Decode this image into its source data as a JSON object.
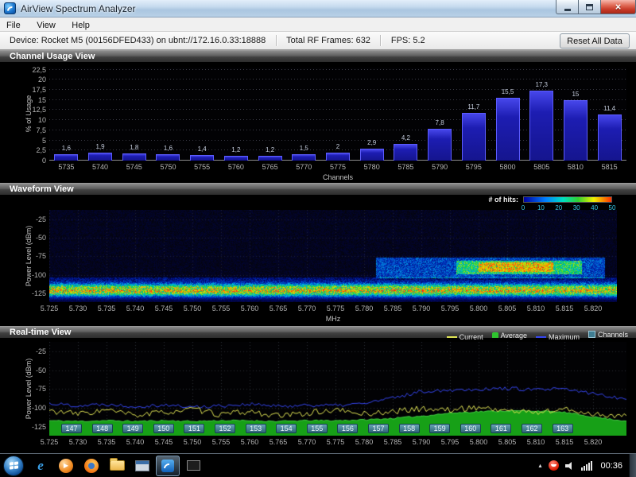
{
  "window": {
    "title": "AirView Spectrum Analyzer"
  },
  "glyphs": {
    "close": "×",
    "ie": "e",
    "play": "▶",
    "chevron": "▴"
  },
  "menu": {
    "items": [
      "File",
      "View",
      "Help"
    ]
  },
  "statusbar": {
    "device": "Device: Rocket M5 (00156DFED433) on ubnt://172.16.0.33:18888",
    "frames": "Total RF Frames: 632",
    "fps": "FPS: 5.2",
    "reset_button": "Reset All Data"
  },
  "channel_usage": {
    "title": "Channel Usage View",
    "ylabel": "% of Usage",
    "xlabel": "Channels"
  },
  "waveform": {
    "title": "Waveform View",
    "hits_label": "# of hits:",
    "hits_ticks": [
      "0",
      "10",
      "20",
      "30",
      "40",
      "50"
    ],
    "ylabel": "Power Level (dBm)",
    "xlabel": "MHz",
    "yticks": [
      -25,
      -50,
      -75,
      -100,
      -125
    ],
    "xticks": [
      "5.725",
      "5.730",
      "5.735",
      "5.740",
      "5.745",
      "5.750",
      "5.755",
      "5.760",
      "5.765",
      "5.770",
      "5.775",
      "5.780",
      "5.785",
      "5.790",
      "5.795",
      "5.800",
      "5.805",
      "5.810",
      "5.815",
      "5.820"
    ]
  },
  "realtime": {
    "title": "Real-time View",
    "ylabel": "Power Level (dBm)",
    "yticks": [
      -25,
      -50,
      -75,
      -100,
      -125
    ],
    "xticks": [
      "5.725",
      "5.730",
      "5.735",
      "5.740",
      "5.745",
      "5.750",
      "5.755",
      "5.760",
      "5.765",
      "5.770",
      "5.775",
      "5.780",
      "5.785",
      "5.790",
      "5.795",
      "5.800",
      "5.805",
      "5.810",
      "5.815",
      "5.820"
    ],
    "channels": [
      "147",
      "148",
      "149",
      "150",
      "151",
      "152",
      "153",
      "154",
      "155",
      "156",
      "157",
      "158",
      "159",
      "160",
      "161",
      "162",
      "163"
    ],
    "legend": [
      {
        "label": "Current",
        "color": "#e0e455",
        "type": "line"
      },
      {
        "label": "Average",
        "color": "#2ec42e",
        "type": "area"
      },
      {
        "label": "Maximum",
        "color": "#3646f0",
        "type": "line"
      },
      {
        "label": "Channels",
        "color": "#3f7d92",
        "type": "box"
      }
    ]
  },
  "taskbar": {
    "time": "00:36"
  },
  "chart_data": [
    {
      "type": "bar",
      "title": "Channel Usage View",
      "xlabel": "Channels",
      "ylabel": "% of Usage",
      "categories": [
        "5735",
        "5740",
        "5745",
        "5750",
        "5755",
        "5760",
        "5765",
        "5770",
        "5775",
        "5780",
        "5785",
        "5790",
        "5795",
        "5800",
        "5805",
        "5810",
        "5815"
      ],
      "values": [
        1.6,
        1.9,
        1.8,
        1.6,
        1.4,
        1.2,
        1.2,
        1.5,
        2,
        2.9,
        4.2,
        7.8,
        11.7,
        15.5,
        17.3,
        15,
        11.4
      ],
      "value_labels": [
        "1,6",
        "1,9",
        "1,8",
        "1,6",
        "1,4",
        "1,2",
        "1,2",
        "1,5",
        "2",
        "2,9",
        "4,2",
        "7,8",
        "11,7",
        "15,5",
        "17,3",
        "15",
        "11,4"
      ],
      "ylim": [
        0,
        23
      ],
      "ytick_values": [
        0,
        2.5,
        5,
        7.5,
        10,
        12.5,
        15,
        17.5,
        20,
        22.5
      ],
      "ytick_labels": [
        "0",
        "2,5",
        "5",
        "7,5",
        "10",
        "12,5",
        "15",
        "17,5",
        "20",
        "22,5"
      ],
      "grid_values": [
        2.5,
        5,
        7.5,
        10,
        12.5,
        15,
        17.5,
        20,
        22.5
      ],
      "bar_color": "#2222c8",
      "grid": true,
      "legend_position": "none"
    },
    {
      "type": "heatmap",
      "title": "Waveform View",
      "xlabel": "MHz",
      "ylabel": "Power Level (dBm)",
      "x_range": [
        5.725,
        5.825
      ],
      "y_range": [
        -137,
        -12
      ],
      "hits_range": [
        0,
        50
      ],
      "colormap_stops": [
        [
          0,
          "#04040c"
        ],
        [
          0.12,
          "#000668"
        ],
        [
          0.3,
          "#0034c4"
        ],
        [
          0.45,
          "#00b8e8"
        ],
        [
          0.6,
          "#00cc58"
        ],
        [
          0.75,
          "#d8e800"
        ],
        [
          0.88,
          "#ff8800"
        ],
        [
          1,
          "#ff2010"
        ]
      ],
      "noise_floor": {
        "center_dbm": -121,
        "spread_dbm": 6
      },
      "haze": {
        "p_top": -103,
        "p_bottom": -117,
        "intensity": 0.22
      },
      "signal_blocks": [
        {
          "x0": 5.782,
          "x1": 5.822,
          "p0": -104,
          "p1": -76,
          "i": 0.3
        },
        {
          "x0": 5.796,
          "x1": 5.818,
          "p0": -99,
          "p1": -80,
          "i": 0.3
        },
        {
          "x0": 5.8,
          "x1": 5.813,
          "p0": -95,
          "p1": -83,
          "i": 0.25
        }
      ]
    },
    {
      "type": "line",
      "title": "Real-time View",
      "xlabel": "MHz",
      "ylabel": "Power Level (dBm)",
      "ylim": [
        -137,
        -12
      ],
      "x": [
        5.725,
        5.73,
        5.735,
        5.74,
        5.745,
        5.75,
        5.755,
        5.76,
        5.765,
        5.77,
        5.775,
        5.78,
        5.785,
        5.79,
        5.795,
        5.8,
        5.805,
        5.81,
        5.815,
        5.82,
        5.825
      ],
      "series": [
        {
          "name": "Current",
          "color": "#e0e455",
          "values": [
            -104,
            -108,
            -103,
            -110,
            -106,
            -102,
            -109,
            -105,
            -111,
            -107,
            -103,
            -108,
            -105,
            -101,
            -103,
            -99,
            -104,
            -106,
            -102,
            -108,
            -111
          ]
        },
        {
          "name": "Average",
          "color": "#2ec42e",
          "values": [
            -117,
            -118,
            -117,
            -118,
            -117,
            -118,
            -117,
            -117,
            -118,
            -117,
            -117,
            -116,
            -114,
            -111,
            -107,
            -105,
            -104,
            -104,
            -106,
            -112,
            -117
          ]
        },
        {
          "name": "Maximum",
          "color": "#3646f0",
          "values": [
            -94,
            -97,
            -95,
            -98,
            -96,
            -99,
            -97,
            -95,
            -98,
            -96,
            -97,
            -94,
            -87,
            -78,
            -76,
            -75,
            -74,
            -76,
            -75,
            -81,
            -87
          ]
        }
      ]
    }
  ]
}
